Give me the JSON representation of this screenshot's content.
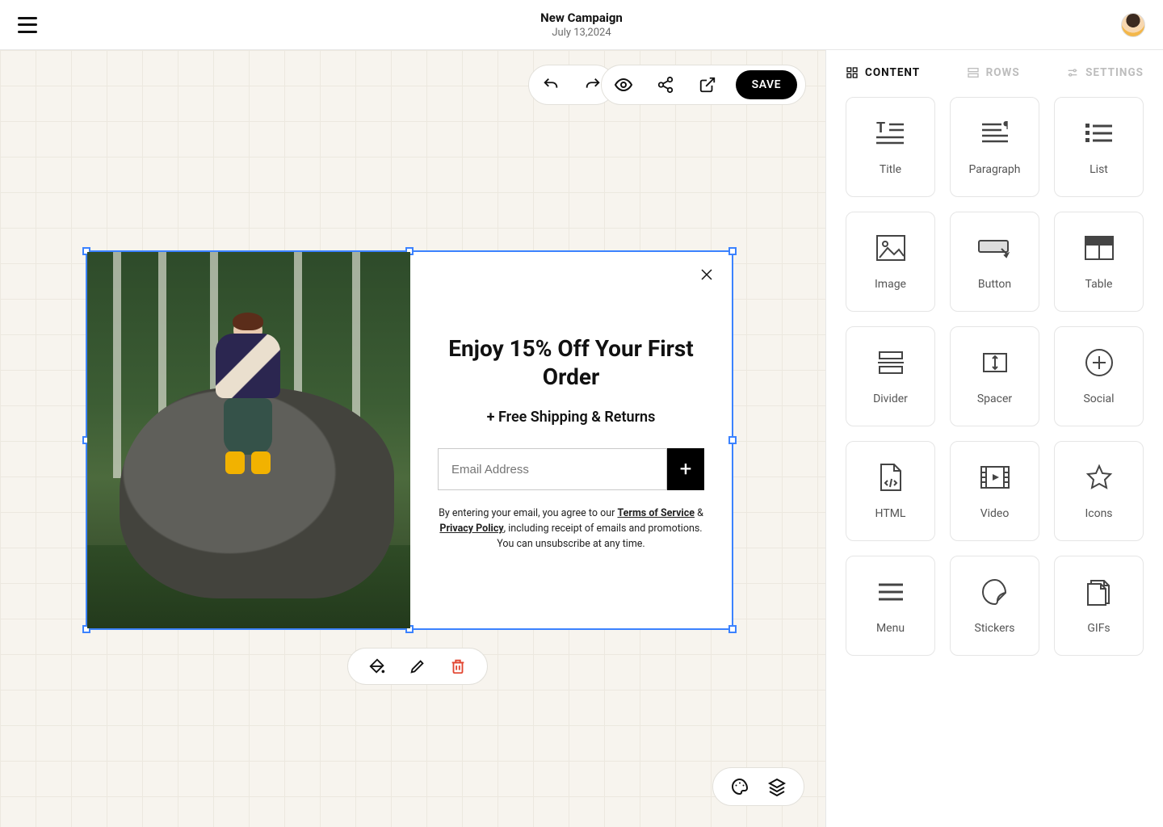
{
  "header": {
    "title": "New Campaign",
    "date": "July 13,2024"
  },
  "toolbar": {
    "save_label": "SAVE"
  },
  "promo": {
    "heading": "Enjoy 15% Off Your First Order",
    "subheading": "+ Free Shipping & Returns",
    "email_placeholder": "Email Address",
    "fineprint_prefix": "By entering your email, you agree to our ",
    "terms_label": "Terms of Service",
    "amp": " & ",
    "privacy_label": "Privacy Policy",
    "fineprint_suffix": ", including receipt of emails and promotions.",
    "unsubscribe": "You can unsubscribe at any time."
  },
  "sidebar": {
    "tabs": {
      "content": "CONTENT",
      "rows": "ROWS",
      "settings": "SETTINGS"
    },
    "tiles": {
      "title": "Title",
      "paragraph": "Paragraph",
      "list": "List",
      "image": "Image",
      "button": "Button",
      "table": "Table",
      "divider": "Divider",
      "spacer": "Spacer",
      "social": "Social",
      "html": "HTML",
      "video": "Video",
      "icons": "Icons",
      "menu": "Menu",
      "stickers": "Stickers",
      "gifs": "GIFs"
    }
  }
}
